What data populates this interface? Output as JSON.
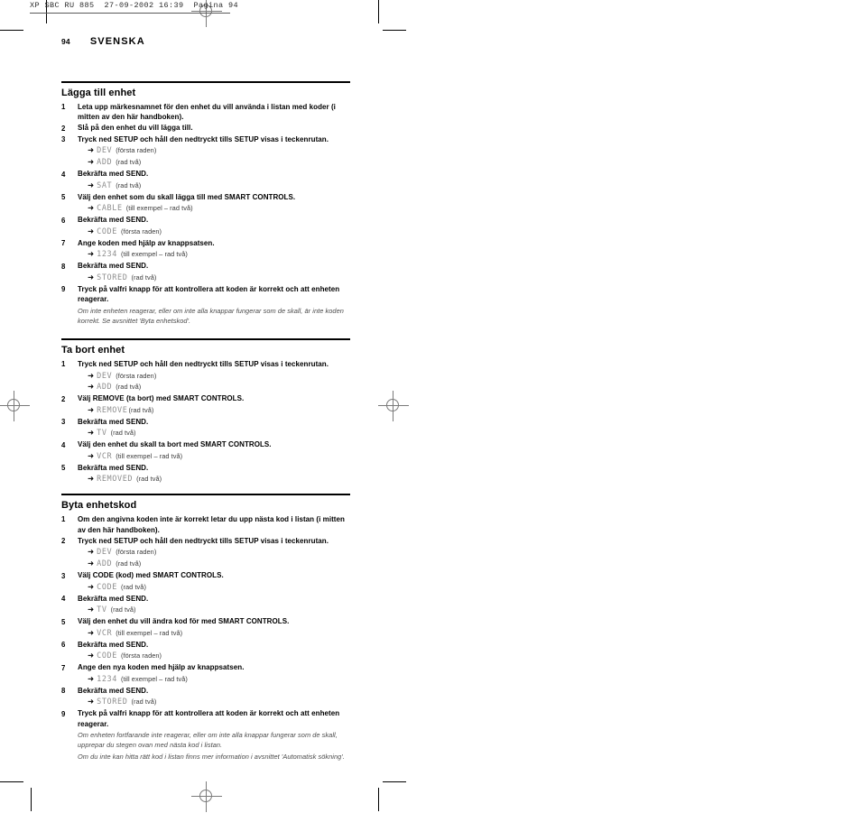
{
  "print_header": {
    "text": "XP SBC RU 885  27-09-2002 16:39  Pagina 94"
  },
  "folio": {
    "number": "94",
    "language": "SVENSKA"
  },
  "icons": {
    "arrow": "➜"
  },
  "sections": [
    {
      "heading": "Lägga till enhet",
      "steps": [
        {
          "num": "1",
          "text": "Leta upp märkesnamnet för den enhet du vill använda i listan med koder (i mitten av den här handboken).",
          "displays": []
        },
        {
          "num": "2",
          "text": "Slå på den enhet du vill lägga till.",
          "displays": []
        },
        {
          "num": "3",
          "text": "Tryck ned SETUP och håll den nedtryckt tills SETUP visas i teckenrutan.",
          "displays": [
            {
              "code": "DEV",
              "note": "(första raden)"
            },
            {
              "code": "ADD",
              "note": "(rad två)"
            }
          ]
        },
        {
          "num": "4",
          "text": "Bekräfta med SEND.",
          "displays": [
            {
              "code": "SAT",
              "note": "(rad två)"
            }
          ]
        },
        {
          "num": "5",
          "text": "Välj den enhet som du skall lägga till med SMART CONTROLS.",
          "displays": [
            {
              "code": "CABLE",
              "note": "(till exempel – rad två)"
            }
          ]
        },
        {
          "num": "6",
          "text": "Bekräfta med SEND.",
          "displays": [
            {
              "code": "CODE",
              "note": "(första raden)"
            }
          ]
        },
        {
          "num": "7",
          "text": "Ange koden med hjälp av knappsatsen.",
          "displays": [
            {
              "code": "1234",
              "note": "(till exempel – rad två)"
            }
          ]
        },
        {
          "num": "8",
          "text": "Bekräfta med SEND.",
          "displays": [
            {
              "code": "STORED",
              "note": "(rad två)"
            }
          ]
        },
        {
          "num": "9",
          "text": "Tryck på valfri knapp för att kontrollera att koden är korrekt och att enheten reagerar.",
          "displays": [],
          "notes": [
            "Om inte enheten reagerar, eller om inte alla knappar fungerar som de skall, är inte koden korrekt. Se avsnittet 'Byta enhetskod'."
          ]
        }
      ]
    },
    {
      "heading": "Ta bort enhet",
      "steps": [
        {
          "num": "1",
          "text": "Tryck ned SETUP och håll den nedtryckt tills SETUP visas i teckenrutan.",
          "displays": [
            {
              "code": "DEV",
              "note": "(första raden)"
            },
            {
              "code": "ADD",
              "note": "(rad två)"
            }
          ]
        },
        {
          "num": "2",
          "text": "Välj REMOVE (ta bort) med SMART CONTROLS.",
          "displays": [
            {
              "code": "REMOVE",
              "note": "(rad två)",
              "tight": true
            }
          ]
        },
        {
          "num": "3",
          "text": "Bekräfta med SEND.",
          "displays": [
            {
              "code": "TV",
              "note": "(rad två)"
            }
          ]
        },
        {
          "num": "4",
          "text": "Välj den enhet du skall ta bort med SMART CONTROLS.",
          "displays": [
            {
              "code": "VCR",
              "note": "(till exempel – rad två)"
            }
          ]
        },
        {
          "num": "5",
          "text": "Bekräfta med SEND.",
          "displays": [
            {
              "code": "REMOVED",
              "note": "(rad två)"
            }
          ]
        }
      ]
    },
    {
      "heading": "Byta enhetskod",
      "steps": [
        {
          "num": "1",
          "text": "Om den angivna koden inte är korrekt letar du upp nästa kod i listan (i mitten av den här handboken).",
          "displays": []
        },
        {
          "num": "2",
          "text": "Tryck ned SETUP och håll den nedtryckt tills SETUP visas i teckenrutan.",
          "displays": [
            {
              "code": "DEV",
              "note": "(första raden)"
            },
            {
              "code": "ADD",
              "note": "(rad två)"
            }
          ]
        },
        {
          "num": "3",
          "text": "Välj CODE (kod) med SMART CONTROLS.",
          "displays": [
            {
              "code": "CODE",
              "note": "(rad två)"
            }
          ]
        },
        {
          "num": "4",
          "text": "Bekräfta med SEND.",
          "displays": [
            {
              "code": "TV",
              "note": "(rad två)"
            }
          ]
        },
        {
          "num": "5",
          "text": "Välj den enhet du vill ändra kod för med SMART CONTROLS.",
          "displays": [
            {
              "code": "VCR",
              "note": "(till exempel – rad två)"
            }
          ]
        },
        {
          "num": "6",
          "text": "Bekräfta med SEND.",
          "displays": [
            {
              "code": "CODE",
              "note": "(första raden)"
            }
          ]
        },
        {
          "num": "7",
          "text": "Ange den nya koden med hjälp av knappsatsen.",
          "displays": [
            {
              "code": "1234",
              "note": "(till exempel – rad två)"
            }
          ]
        },
        {
          "num": "8",
          "text": "Bekräfta med SEND.",
          "displays": [
            {
              "code": "STORED",
              "note": "(rad två)"
            }
          ]
        },
        {
          "num": "9",
          "text": "Tryck på valfri knapp för att kontrollera att koden är korrekt och att enheten reagerar.",
          "displays": [],
          "notes": [
            "Om enheten fortfarande inte reagerar, eller om inte alla knappar fungerar som de skall, upprepar du stegen ovan med nästa kod i listan.",
            "Om du inte kan hitta rätt kod i listan finns mer information i avsnittet 'Automatisk sökning'."
          ]
        }
      ]
    }
  ]
}
